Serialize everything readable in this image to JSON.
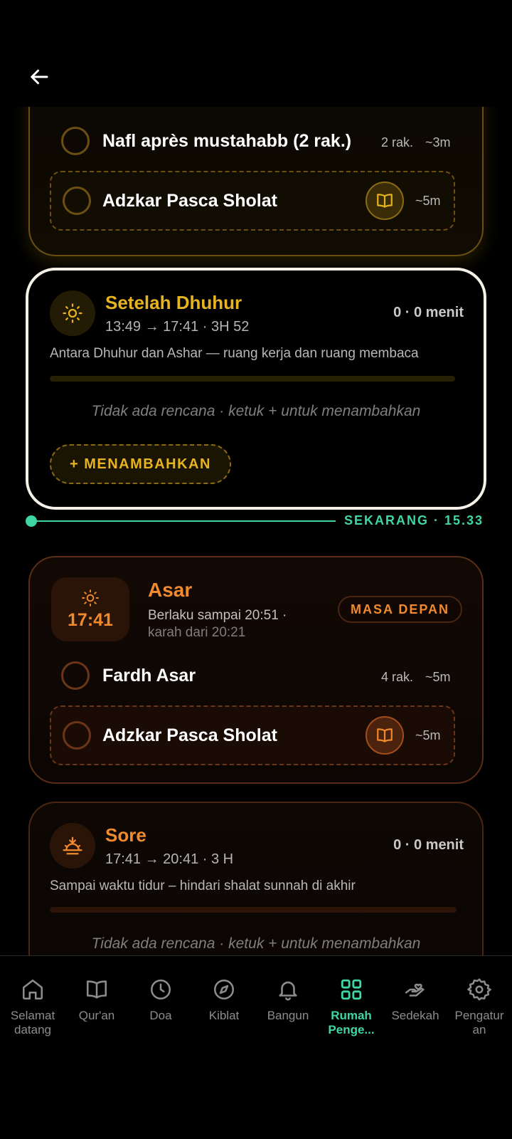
{
  "topbar": {
    "back_icon": "arrow-left-icon"
  },
  "card_dhuhur": {
    "rows": [
      {
        "title": "Nafl après mustahabb (2 rak.)",
        "rakat": "2 rak.",
        "duration": "~3m"
      },
      {
        "title": "Adzkar Pasca Sholat",
        "duration": "~5m",
        "icon": "book-open-icon"
      }
    ]
  },
  "card_setelah_dhuhur": {
    "title": "Setelah Dhuhur",
    "time": "13:49 → 17:41 · 3H 52",
    "count": "0 · 0 menit",
    "description": "Antara Dhuhur dan Ashar — ruang kerja dan ruang membaca",
    "empty": "Tidak ada rencana · ketuk + untuk menambahkan",
    "add_label": "+ MENAMBAHKAN",
    "icon": "sun-icon"
  },
  "now": {
    "label": "SEKARANG · 15.33"
  },
  "card_asar": {
    "time": "17:41",
    "title": "Asar",
    "subtitle": "Berlaku sampai 20:51 ·",
    "subtitle_dim": "karah dari 20:21",
    "badge": "MASA DEPAN",
    "rows": [
      {
        "title": "Fardh Asar",
        "rakat": "4 rak.",
        "duration": "~5m"
      },
      {
        "title": "Adzkar Pasca Sholat",
        "duration": "~5m"
      }
    ]
  },
  "card_sore": {
    "title": "Sore",
    "time": "17:41 → 20:41 · 3 H",
    "count": "0 · 0 menit",
    "description": "Sampai waktu tidur – hindari shalat sunnah di akhir",
    "empty": "Tidak ada rencana · ketuk + untuk menambahkan"
  },
  "nav": [
    {
      "label": "Selamat datang",
      "icon": "home-icon"
    },
    {
      "label": "Qur'an",
      "icon": "book-icon"
    },
    {
      "label": "Doa",
      "icon": "clock-icon"
    },
    {
      "label": "Kiblat",
      "icon": "compass-icon"
    },
    {
      "label": "Bangun",
      "icon": "bell-icon"
    },
    {
      "label": "Rumah Penge...",
      "icon": "grid-icon",
      "active": true
    },
    {
      "label": "Sedekah",
      "icon": "hand-heart-icon"
    },
    {
      "label": "Pengatur an",
      "icon": "gear-icon"
    }
  ],
  "colors": {
    "gold": "#e7b320",
    "orange": "#f08a2c",
    "accent": "#3fd6a6"
  }
}
